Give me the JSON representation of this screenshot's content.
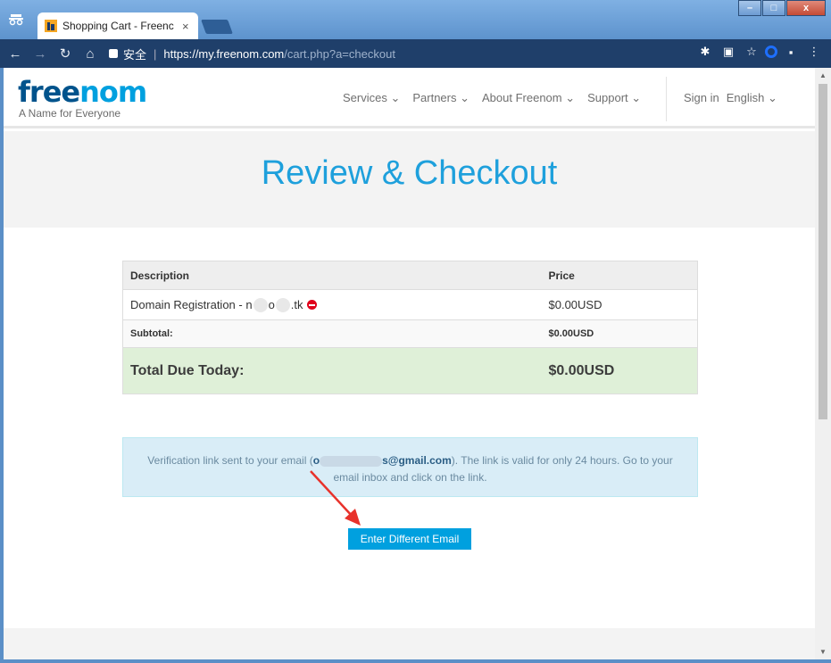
{
  "browser": {
    "tab_title": "Shopping Cart - Freenc",
    "tab_close": "×",
    "secure_label": "安全",
    "url_separator": "|",
    "url_host": "https://my.freenom.com",
    "url_path": "/cart.php?a=checkout",
    "window_buttons": {
      "minimize": "–",
      "maximize": "□",
      "close": "x"
    }
  },
  "site": {
    "logo_part1": "free",
    "logo_part2": "nom",
    "tagline": "A Name for Everyone",
    "nav": {
      "services": "Services ⌄",
      "partners": "Partners ⌄",
      "about": "About Freenom ⌄",
      "support": "Support ⌄",
      "signin": "Sign in",
      "language": "English ⌄"
    }
  },
  "page": {
    "title": "Review & Checkout"
  },
  "order": {
    "headers": {
      "description": "Description",
      "price": "Price"
    },
    "item": {
      "description_prefix": "Domain Registration - n",
      "domain_mid": "o",
      "domain_suffix": ".tk",
      "price": "$0.00USD"
    },
    "subtotal": {
      "label": "Subtotal:",
      "value": "$0.00USD"
    },
    "total": {
      "label": "Total Due Today:",
      "value": "$0.00USD"
    }
  },
  "notice": {
    "text_before": "Verification link sent to your email (",
    "email_start": "o",
    "email_end": "s@gmail.com",
    "text_after": "). The link is valid for only 24 hours. Go to your email inbox and click on the link."
  },
  "actions": {
    "enter_different_email": "Enter Different Email"
  },
  "colors": {
    "brand_blue": "#00a0df",
    "brand_dark": "#00538c",
    "total_bg": "#dff0d8",
    "notice_bg": "#d9edf7",
    "arrow": "#e8322b"
  },
  "icons": {
    "incognito": "incognito-icon",
    "back": "back-arrow-icon",
    "forward": "forward-arrow-icon",
    "reload": "reload-icon",
    "home": "home-icon",
    "lock": "lock-icon",
    "remove": "remove-item-icon"
  }
}
